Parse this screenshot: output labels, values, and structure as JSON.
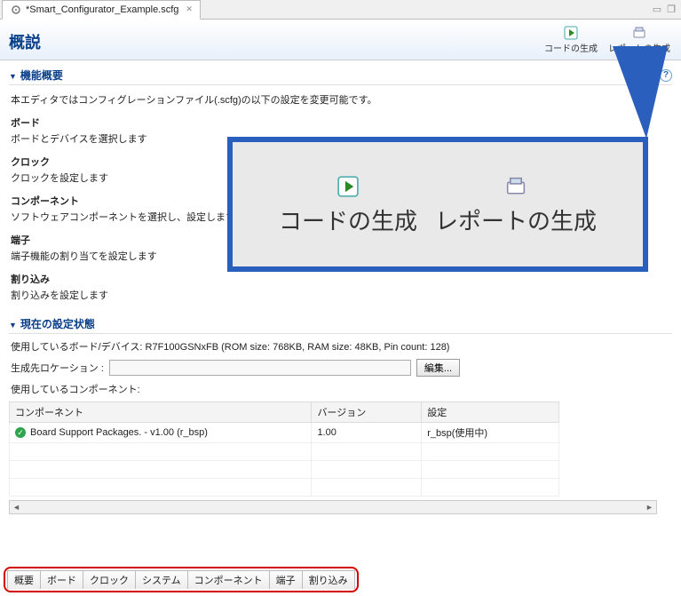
{
  "tab": {
    "filename": "*Smart_Configurator_Example.scfg",
    "close_glyph": "✕"
  },
  "header": {
    "title": "概説",
    "code_gen_label": "コードの生成",
    "report_gen_label": "レポートの生成"
  },
  "overview": {
    "section_title": "機能概要",
    "intro": "本エディタではコンフィグレーションファイル(.scfg)の以下の設定を変更可能です。",
    "items": [
      {
        "h": "ボード",
        "d": "ボードとデバイスを選択します"
      },
      {
        "h": "クロック",
        "d": "クロックを設定します"
      },
      {
        "h": "コンポーネント",
        "d": "ソフトウェアコンポーネントを選択し、設定します"
      },
      {
        "h": "端子",
        "d": "端子機能の割り当てを設定します"
      },
      {
        "h": "割り込み",
        "d": "割り込みを設定します"
      }
    ],
    "help_glyph": "?"
  },
  "status": {
    "section_title": "現在の設定状態",
    "board_line": "使用しているボード/デバイス: R7F100GSNxFB (ROM size: 768KB, RAM size: 48KB, Pin count: 128)",
    "location_label": "生成先ロケーション :",
    "location_value": "",
    "browse_label": "編集...",
    "components_label": "使用しているコンポーネント:",
    "columns": {
      "name": "コンポーネント",
      "version": "バージョン",
      "config": "設定"
    },
    "rows": [
      {
        "name": "Board Support Packages. - v1.00 (r_bsp)",
        "version": "1.00",
        "config": "r_bsp(使用中)"
      }
    ]
  },
  "bottom_tabs": [
    "概要",
    "ボード",
    "クロック",
    "システム",
    "コンポーネント",
    "端子",
    "割り込み"
  ],
  "zoom": {
    "code_gen_label": "コードの生成",
    "report_gen_label": "レポートの生成"
  }
}
